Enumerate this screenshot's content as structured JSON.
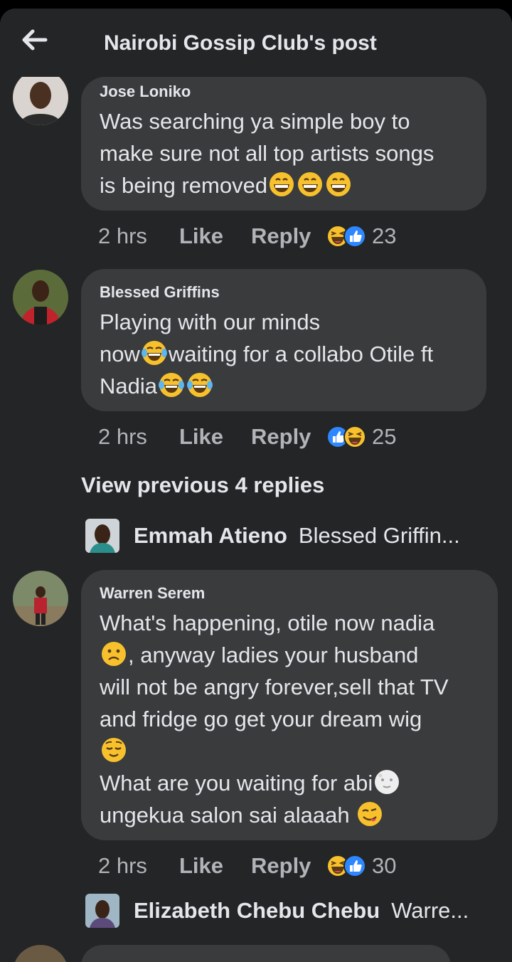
{
  "header": {
    "title": "Nairobi Gossip Club's post"
  },
  "comments": [
    {
      "author": "Jose Loniko",
      "lines": [
        "Was searching ya simple boy to",
        "make sure not all top artists songs",
        "is being removed"
      ],
      "time": "2 hrs",
      "like": "Like",
      "reply": "Reply",
      "reaction_count": "23"
    },
    {
      "author": "Blessed Griffins",
      "lines": [
        "Playing with our minds",
        "now",
        "waiting for a collabo Otile ft",
        "Nadia"
      ],
      "time": "2 hrs",
      "like": "Like",
      "reply": "Reply",
      "reaction_count": "25"
    },
    {
      "author": "Warren Serem",
      "lines": [
        "What's happening, otile now nadia",
        ", anyway ladies your husband",
        "will not be angry forever,sell that TV",
        "and fridge go get your dream wig",
        "What are you waiting for abi",
        "ungekua salon sai alaaah "
      ],
      "time": "2 hrs",
      "like": "Like",
      "reply": "Reply",
      "reaction_count": "30"
    }
  ],
  "view_previous": "View previous 4 replies",
  "replies": [
    {
      "name": "Emmah Atieno",
      "text": "Blessed Griffin..."
    },
    {
      "name": "Elizabeth Chebu Chebu",
      "text": "Warre..."
    }
  ]
}
